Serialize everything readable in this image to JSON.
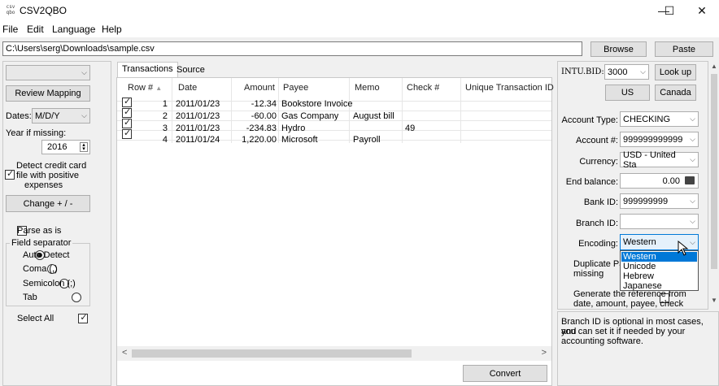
{
  "window": {
    "title": "CSV2QBO",
    "app_icon_text": "csv\nqbo",
    "minimize_glyph": "—",
    "maximize_glyph": "☐",
    "close_glyph": "✕"
  },
  "menu": {
    "items": [
      "File",
      "Edit",
      "Language",
      "Help"
    ]
  },
  "path": {
    "value": "C:\\Users\\serg\\Downloads\\sample.csv"
  },
  "toolbar": {
    "browse_label": "Browse",
    "paste_label": "Paste"
  },
  "left": {
    "profile_value": "",
    "review_mapping_label": "Review Mapping",
    "dates_label": "Dates:",
    "dates_value": "M/D/Y",
    "year_missing_label": "Year if missing:",
    "year_value": "2016",
    "detect_credit_label_1": "Detect credit card",
    "detect_credit_label_2": "file with positive",
    "detect_credit_label_3": "expenses",
    "detect_credit_checked": true,
    "change_sign_label": "Change + / -",
    "parse_as_is_label": "Parse as is",
    "parse_as_is_checked": false,
    "field_separator_label": "Field separator",
    "separators": [
      {
        "label": "Auto Detect",
        "checked": true
      },
      {
        "label": "Coma (,)",
        "checked": false
      },
      {
        "label": "Semicolon (;)",
        "checked": false
      },
      {
        "label": "Tab",
        "checked": false
      }
    ],
    "select_all_label": "Select All",
    "select_all_checked": true
  },
  "tabs": [
    {
      "label": "Transactions",
      "active": true
    },
    {
      "label": "Source",
      "active": false
    }
  ],
  "table": {
    "headers": [
      "Row #",
      "Date",
      "Amount",
      "Payee",
      "Memo",
      "Check #",
      "Unique Transaction ID"
    ],
    "sort_glyph": "▲",
    "rows": [
      {
        "checked": true,
        "row": "1",
        "date": "2011/01/23",
        "amount": "-12.34",
        "payee": "Bookstore Invoice",
        "memo": "",
        "check": "",
        "uid": ""
      },
      {
        "checked": true,
        "row": "2",
        "date": "2011/01/23",
        "amount": "-60.00",
        "payee": "Gas Company",
        "memo": "August bill",
        "check": "",
        "uid": ""
      },
      {
        "checked": true,
        "row": "3",
        "date": "2011/01/23",
        "amount": "-234.83",
        "payee": "Hydro",
        "memo": "",
        "check": "49",
        "uid": ""
      },
      {
        "checked": true,
        "row": "4",
        "date": "2011/01/24",
        "amount": "1,220.00",
        "payee": "Microsoft",
        "memo": "Payroll",
        "check": "",
        "uid": ""
      }
    ],
    "scroll_left_glyph": "<",
    "scroll_right_glyph": ">"
  },
  "convert_label": "Convert",
  "right": {
    "intu_bid_label": "INTU.BID:",
    "intu_bid_value": "3000",
    "lookup_label": "Look up",
    "us_label": "US",
    "canada_label": "Canada",
    "account_type_label": "Account Type:",
    "account_type_value": "CHECKING",
    "account_num_label": "Account #:",
    "account_num_value": "999999999999",
    "currency_label": "Currency:",
    "currency_value": "USD - United Sta",
    "end_balance_label": "End balance:",
    "end_balance_value": "0.00",
    "bank_id_label": "Bank ID:",
    "bank_id_value": "999999999",
    "branch_id_label": "Branch ID:",
    "branch_id_value": "",
    "encoding_label": "Encoding:",
    "encoding_value": "Western",
    "encoding_options": [
      "Western",
      "Unicode",
      "Hebrew",
      "Japanese"
    ],
    "encoding_selected": "Western",
    "duplicate_label_1": "Duplicate Pa",
    "duplicate_label_2": "missing",
    "duplicate_checked": true,
    "generate_label_1": "Generate the reference from",
    "generate_label_2": "date, amount, payee, check",
    "generate_checked": false,
    "help_text_1": "Branch ID is optional in most cases, and",
    "help_text_2": "you can set it if needed by your",
    "help_text_3": "accounting software."
  },
  "colors": {
    "selection": "#0078d7",
    "background": "#f0f0f0",
    "border": "#adadad"
  }
}
